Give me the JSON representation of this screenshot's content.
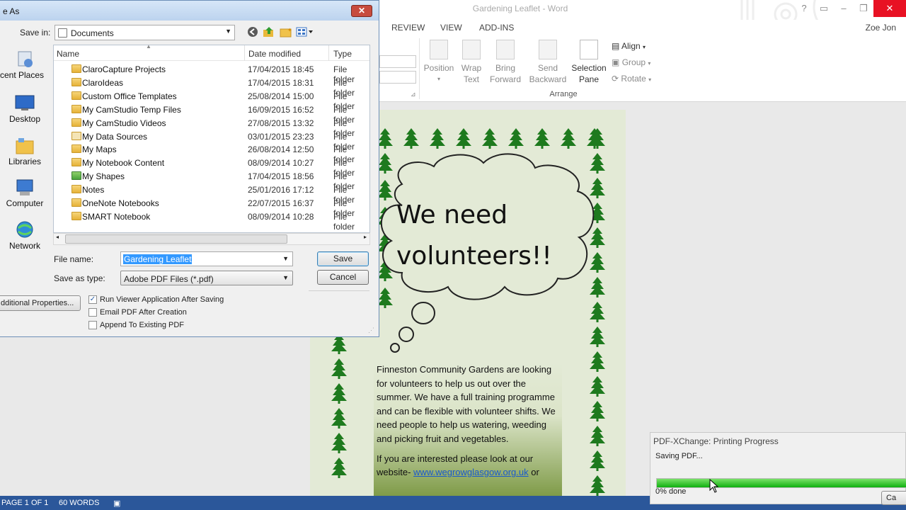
{
  "word": {
    "title": "Gardening Leaflet - Word",
    "user": "Zoe Jon",
    "tabs": [
      "REVIEW",
      "VIEW",
      "ADD-INS"
    ],
    "ribbon": {
      "position": "Position",
      "wrap_text": [
        "Wrap",
        "Text"
      ],
      "bring_forward": [
        "Bring",
        "Forward"
      ],
      "send_backward": [
        "Send",
        "Backward"
      ],
      "selection_pane": [
        "Selection",
        "Pane"
      ],
      "align": "Align",
      "group": "Group",
      "rotate": "Rotate",
      "arrange_group_label": "Arrange"
    },
    "leaflet": {
      "heading_line1": "We need",
      "heading_line2": "volunteers!!",
      "body": "Finneston Community Gardens are looking for volunteers to help us out over the summer. We have a full training programme and can be flexible with volunteer shifts. We need people to help us watering, weeding and picking fruit and vegetables.",
      "contact_prefix": "If you are interested please look at our website-",
      "website": "www.wegrowglasgow.org.uk",
      "contact_suffix": "or"
    },
    "status": {
      "page": "PAGE 1 OF 1",
      "words": "60 WORDS"
    }
  },
  "save_dialog": {
    "title": "e As",
    "save_in_label": "Save in:",
    "save_in_value": "Documents",
    "places": [
      "cent Places",
      "Desktop",
      "Libraries",
      "Computer",
      "Network"
    ],
    "columns": [
      "Name",
      "Date modified",
      "Type"
    ],
    "files": [
      {
        "name": "ClaroCapture Projects",
        "date": "17/04/2015 18:45",
        "type": "File folder",
        "icon": "folder"
      },
      {
        "name": "ClaroIdeas",
        "date": "17/04/2015 18:31",
        "type": "File folder",
        "icon": "folder"
      },
      {
        "name": "Custom Office Templates",
        "date": "25/08/2014 15:00",
        "type": "File folder",
        "icon": "folder"
      },
      {
        "name": "My CamStudio Temp Files",
        "date": "16/09/2015 16:52",
        "type": "File folder",
        "icon": "folder"
      },
      {
        "name": "My CamStudio Videos",
        "date": "27/08/2015 13:32",
        "type": "File folder",
        "icon": "folder"
      },
      {
        "name": "My Data Sources",
        "date": "03/01/2015 23:23",
        "type": "File folder",
        "icon": "data-sources"
      },
      {
        "name": "My Maps",
        "date": "26/08/2014 12:50",
        "type": "File folder",
        "icon": "folder"
      },
      {
        "name": "My Notebook Content",
        "date": "08/09/2014 10:27",
        "type": "File folder",
        "icon": "folder"
      },
      {
        "name": "My Shapes",
        "date": "17/04/2015 18:56",
        "type": "File folder",
        "icon": "shapes"
      },
      {
        "name": "Notes",
        "date": "25/01/2016 17:12",
        "type": "File folder",
        "icon": "folder"
      },
      {
        "name": "OneNote Notebooks",
        "date": "22/07/2015 16:37",
        "type": "File folder",
        "icon": "folder"
      },
      {
        "name": "SMART Notebook",
        "date": "08/09/2014 10:28",
        "type": "File folder",
        "icon": "folder"
      }
    ],
    "file_name_label": "File name:",
    "file_name_value": "Gardening Leaflet",
    "save_as_type_label": "Save as type:",
    "save_as_type_value": "Adobe PDF Files (*.pdf)",
    "save_button": "Save",
    "cancel_button": "Cancel",
    "additional_properties": "dditional Properties...",
    "options": [
      {
        "label": "Run Viewer Application After Saving",
        "checked": true
      },
      {
        "label": "Email PDF After Creation",
        "checked": false
      },
      {
        "label": "Append To Existing PDF",
        "checked": false
      }
    ]
  },
  "progress": {
    "title": "PDF-XChange: Printing Progress",
    "message": "Saving PDF...",
    "percent_text": "0% done",
    "cancel": "Ca"
  },
  "colors": {
    "word_blue": "#2b579a",
    "tree_green": "#1e7a1e",
    "progress_green": "#10b010"
  }
}
